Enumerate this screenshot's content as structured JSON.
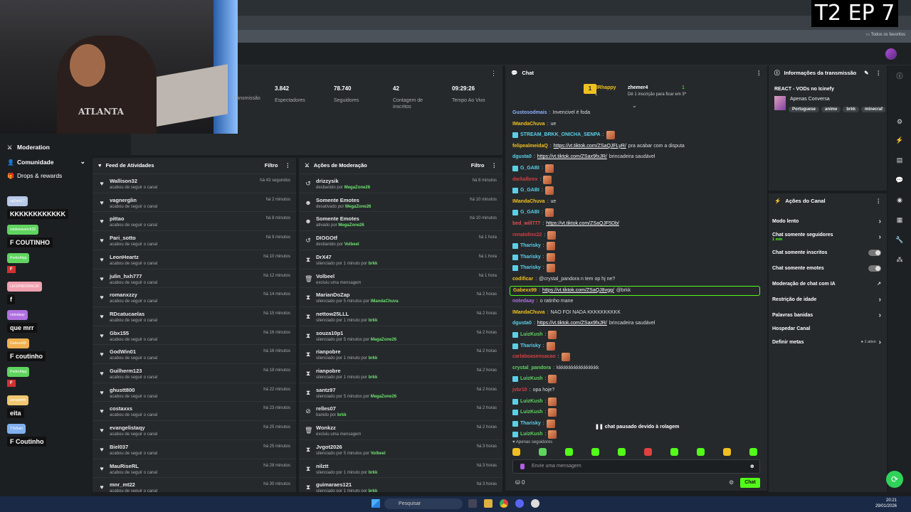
{
  "overlay": {
    "episode": "T2 EP 7",
    "webcam_shirt_text": "ATLANTA"
  },
  "browser": {
    "bookmarks_folder": "Todos os favoritos"
  },
  "sidebar": {
    "items": [
      {
        "label": "Moderation",
        "icon": "sword-icon"
      },
      {
        "label": "Comunidade",
        "icon": "user-icon"
      },
      {
        "label": "Drops & rewards",
        "icon": "gift-icon"
      }
    ]
  },
  "chat_overlay": [
    {
      "user": "og5am17",
      "msg": "KKKKKKKKKKKK",
      "color": "#b8c8e8"
    },
    {
      "user": "voidweaverch32",
      "msg": "F COUTINHO",
      "color": "#5fd45f"
    },
    {
      "user": "PedroAlqq",
      "msg": "F",
      "color": "#5fd45f"
    },
    {
      "user": "LEOZINDGRAL00",
      "msg": "f",
      "color": "#f0a0b0"
    },
    {
      "user": "notedaay",
      "msg": "que mrr",
      "color": "#b070e0"
    },
    {
      "user": "Gabexx99",
      "msg": "F coutinho",
      "color": "#f0b050"
    },
    {
      "user": "PedroAlqq",
      "msg": "F",
      "color": "#5fd45f"
    },
    {
      "user": "zarapafrih",
      "msg": "eita",
      "color": "#f0c870"
    },
    {
      "user": "TTo5am",
      "msg": "F Coutinho",
      "color": "#80b0f0"
    }
  ],
  "stats": [
    {
      "value": "",
      "label": "Transmissão"
    },
    {
      "value": "3.842",
      "label": "Espectadores"
    },
    {
      "value": "78.740",
      "label": "Seguidores"
    },
    {
      "value": "42",
      "label": "Contagem de inscritos"
    },
    {
      "value": "09:29:26",
      "label": "Tempo Ao Vivo"
    }
  ],
  "activity": {
    "title": "Feed de Atividades",
    "filter": "Filtro",
    "rows": [
      {
        "name": "Wallison32",
        "sub": "acabou de seguir o canal",
        "time": "há 43 segundos"
      },
      {
        "name": "vagnerglin",
        "sub": "acabou de seguir o canal",
        "time": "há 2 minutos"
      },
      {
        "name": "pittao",
        "sub": "acabou de seguir o canal",
        "time": "há 8 minutos"
      },
      {
        "name": "Pari_sotto",
        "sub": "acabou de seguir o canal",
        "time": "há 9 minutos"
      },
      {
        "name": "LeonHeartz",
        "sub": "acabou de seguir o canal",
        "time": "há 10 minutos"
      },
      {
        "name": "julin_hxh777",
        "sub": "acabou de seguir o canal",
        "time": "há 12 minutos"
      },
      {
        "name": "romanxzzy",
        "sub": "acabou de seguir o canal",
        "time": "há 14 minutos"
      },
      {
        "name": "RDcatucaelas",
        "sub": "acabou de seguir o canal",
        "time": "há 15 minutos"
      },
      {
        "name": "Gbx155",
        "sub": "acabou de seguir o canal",
        "time": "há 16 minutos"
      },
      {
        "name": "GodWin01",
        "sub": "acabou de seguir o canal",
        "time": "há 16 minutos"
      },
      {
        "name": "Guilherm123",
        "sub": "acabou de seguir o canal",
        "time": "há 18 minutos"
      },
      {
        "name": "ghustt800",
        "sub": "acabou de seguir o canal",
        "time": "há 22 minutos"
      },
      {
        "name": "costaxxs",
        "sub": "acabou de seguir o canal",
        "time": "há 23 minutos"
      },
      {
        "name": "evangelistaqy",
        "sub": "acabou de seguir o canal",
        "time": "há 25 minutos"
      },
      {
        "name": "Biel037",
        "sub": "acabou de seguir o canal",
        "time": "há 25 minutos"
      },
      {
        "name": "MauRiseRL",
        "sub": "acabou de seguir o canal",
        "time": "há 28 minutos"
      },
      {
        "name": "mnr_mt22",
        "sub": "acabou de seguir o canal",
        "time": "há 30 minutos"
      }
    ]
  },
  "moderation": {
    "title": "Ações de Moderação",
    "filter": "Filtro",
    "rows": [
      {
        "name": "drizzysik",
        "sub_pre": "desbanido por",
        "by": "MegaZone26",
        "time": "há 8 minutos",
        "icon": "undo-icon"
      },
      {
        "name": "Somente Emotes",
        "sub_pre": "desativado por",
        "by": "MegaZone26",
        "time": "há 10 minutos",
        "icon": "emote-icon"
      },
      {
        "name": "Somente Emotes",
        "sub_pre": "ativado por",
        "by": "MegaZone26",
        "time": "há 10 minutos",
        "icon": "emote-icon"
      },
      {
        "name": "DIOGOtf",
        "sub_pre": "desbanido por",
        "by": "Volbeel",
        "time": "há 1 hora",
        "icon": "undo-icon"
      },
      {
        "name": "DrX47",
        "sub_pre": "silenciado por 1 minuto por",
        "by": "brkk",
        "time": "há 1 hora",
        "icon": "hourglass-icon"
      },
      {
        "name": "Volbeel",
        "sub_pre": "excluiu uma mensagem",
        "by": "",
        "time": "há 1 hora",
        "icon": "trash-icon"
      },
      {
        "name": "MarianDoZap",
        "sub_pre": "silenciado por 5 minutos por",
        "by": "IMandaChuva",
        "time": "há 2 horas",
        "icon": "hourglass-icon"
      },
      {
        "name": "nettow25LLL",
        "sub_pre": "silenciado por 1 minuto por",
        "by": "brkk",
        "time": "há 2 horas",
        "icon": "hourglass-icon"
      },
      {
        "name": "souza10p1",
        "sub_pre": "silenciado por 5 minutos por",
        "by": "MegaZone26",
        "time": "há 2 horas",
        "icon": "hourglass-icon"
      },
      {
        "name": "rianpobre",
        "sub_pre": "silenciado por 1 minuto por",
        "by": "brkk",
        "time": "há 2 horas",
        "icon": "hourglass-icon"
      },
      {
        "name": "rianpobre",
        "sub_pre": "silenciado por 1 minuto por",
        "by": "brkk",
        "time": "há 2 horas",
        "icon": "hourglass-icon"
      },
      {
        "name": "santz97",
        "sub_pre": "silenciado por 5 minutos por",
        "by": "MegaZone26",
        "time": "há 2 horas",
        "icon": "hourglass-icon"
      },
      {
        "name": "relles07",
        "sub_pre": "banido por",
        "by": "brkk",
        "time": "há 2 horas",
        "icon": "ban-icon"
      },
      {
        "name": "Wonkzz",
        "sub_pre": "excluiu uma mensagem",
        "by": "",
        "time": "há 2 horas",
        "icon": "trash-icon"
      },
      {
        "name": "Jvgot2026",
        "sub_pre": "silenciado por 5 minutos por",
        "by": "Volbeel",
        "time": "há 3 horas",
        "icon": "hourglass-icon"
      },
      {
        "name": "nilztt",
        "sub_pre": "silenciado por 1 minuto por",
        "by": "brkk",
        "time": "há 3 horas",
        "icon": "hourglass-icon"
      },
      {
        "name": "guimaraes121",
        "sub_pre": "silenciado por 1 minuto por",
        "by": "brkk",
        "time": "há 3 horas",
        "icon": "hourglass-icon"
      }
    ]
  },
  "chat": {
    "title": "Chat",
    "leaders": [
      {
        "name": "JRhappy",
        "count": "1"
      },
      {
        "name": "zhemer4",
        "count": "1"
      }
    ],
    "leader_note": "Dê 1 inscrição para ficar em 3º",
    "messages": [
      {
        "user": "Gustosodmais",
        "color": "#8fb0ff",
        "text": "Invencivel é foda",
        "link": "",
        "tail": "",
        "emote": false
      },
      {
        "user": "IMandaChuva",
        "color": "#f0c020",
        "text": "ue",
        "link": "",
        "tail": "",
        "emote": false
      },
      {
        "user": "STREAM_BRKK_ONICHA_SENPA",
        "color": "#5ad0e8",
        "text": "",
        "link": "",
        "tail": "",
        "emote": true
      },
      {
        "user": "felipealmeidaQ",
        "color": "#f0c020",
        "text": "",
        "link": "https://vt.tiktok.com/ZSaQJFLyR/",
        "tail": "pra acabar com a disputa",
        "emote": false
      },
      {
        "user": "dgusta0",
        "color": "#5ad0e8",
        "text": "",
        "link": "https://vt.tiktok.com/ZSax9fxJR/",
        "tail": "brincadeira saudável",
        "emote": false
      },
      {
        "user": "G_GABI",
        "color": "#5ad0e8",
        "text": "",
        "link": "",
        "tail": "",
        "emote": true
      },
      {
        "user": "darkalbrex",
        "color": "#d04040",
        "text": "",
        "link": "",
        "tail": "",
        "emote": true
      },
      {
        "user": "G_GABI",
        "color": "#5ad0e8",
        "text": "",
        "link": "",
        "tail": "",
        "emote": true
      },
      {
        "user": "IMandaChuva",
        "color": "#f0c020",
        "text": "ue",
        "link": "",
        "tail": "",
        "emote": false
      },
      {
        "user": "G_GABI",
        "color": "#5ad0e8",
        "text": "",
        "link": "",
        "tail": "",
        "emote": true
      },
      {
        "user": "bed_will777",
        "color": "#e05050",
        "text": "",
        "link": "https://vt.tiktok.com/ZSaQJF5Db/",
        "tail": "",
        "emote": false
      },
      {
        "user": "renatolinx22",
        "color": "#d04040",
        "text": "",
        "link": "",
        "tail": "",
        "emote": true
      },
      {
        "user": "Tharisky",
        "color": "#5ad0e8",
        "text": "",
        "link": "",
        "tail": "",
        "emote": true
      },
      {
        "user": "Tharisky",
        "color": "#5ad0e8",
        "text": "",
        "link": "",
        "tail": "",
        "emote": true
      },
      {
        "user": "Tharisky",
        "color": "#5ad0e8",
        "text": "",
        "link": "",
        "tail": "",
        "emote": true
      },
      {
        "user": "codificar",
        "color": "#f0c020",
        "text": "@crystal_pandora n tem op hj ne?",
        "link": "",
        "tail": "",
        "emote": false
      },
      {
        "user": "Gabexx99",
        "color": "#f0c020",
        "text": "",
        "link": "https://vt.tiktok.com/ZSaQJ8vgg/",
        "tail": "@brkk",
        "emote": false
      },
      {
        "user": "notedaay",
        "color": "#b070e0",
        "text": "o ratinho mane",
        "link": "",
        "tail": "",
        "emote": false
      },
      {
        "user": "IMandaChuva",
        "color": "#f0c020",
        "text": "NAO FOI NADA KKKKKKKKKK",
        "link": "",
        "tail": "",
        "emote": false
      },
      {
        "user": "dgusta0",
        "color": "#5ad0e8",
        "text": "",
        "link": "https://vt.tiktok.com/ZSax9fxJR/",
        "tail": "brincadeira saudável",
        "emote": false
      },
      {
        "user": "LuizKush",
        "color": "#5fd45f",
        "text": "",
        "link": "",
        "tail": "",
        "emote": true
      },
      {
        "user": "Tharisky",
        "color": "#5ad0e8",
        "text": "",
        "link": "",
        "tail": "",
        "emote": true
      },
      {
        "user": "carlaboasensacao",
        "color": "#d04040",
        "text": "",
        "link": "",
        "tail": "",
        "emote": true
      },
      {
        "user": "crystal_pandora",
        "color": "#5fd45f",
        "text": "kkkkkkkkkkkkkkkkk",
        "link": "",
        "tail": "",
        "emote": false
      },
      {
        "user": "LuizKush",
        "color": "#5fd45f",
        "text": "",
        "link": "",
        "tail": "",
        "emote": true
      },
      {
        "user": "jvbr10",
        "color": "#d04040",
        "text": "opa hoje?",
        "link": "",
        "tail": "",
        "emote": false
      },
      {
        "user": "LuizKush",
        "color": "#5fd45f",
        "text": "",
        "link": "",
        "tail": "",
        "emote": true
      },
      {
        "user": "LuizKush",
        "color": "#5fd45f",
        "text": "",
        "link": "",
        "tail": "",
        "emote": true
      },
      {
        "user": "Tharisky",
        "color": "#5ad0e8",
        "text": "",
        "link": "",
        "tail": "",
        "emote": true
      },
      {
        "user": "LuizKush",
        "color": "#5fd45f",
        "text": "",
        "link": "",
        "tail": "",
        "emote": true
      }
    ],
    "paused": "chat pausado devido à rolagem",
    "followers_only": "Apenas seguidores",
    "input_placeholder": "Envie uma mensagem",
    "points": "0",
    "send": "Chat"
  },
  "info": {
    "title": "Informações da transmissão",
    "stream_title": "REACT - VODs no Icinefy",
    "category": "Apenas Conversa",
    "tags": [
      "Portuguese",
      "anime",
      "brkk",
      "minecraf"
    ]
  },
  "actions": {
    "title": "Ações do Canal",
    "items": [
      {
        "label": "Modo lento",
        "kind": "chevron",
        "sub": "",
        "extra": ""
      },
      {
        "label": "Chat somente seguidores",
        "kind": "chevron",
        "sub": "1 min",
        "extra": ""
      },
      {
        "label": "Chat somente inscritos",
        "kind": "toggle",
        "sub": "",
        "extra": ""
      },
      {
        "label": "Chat somente emotes",
        "kind": "toggle",
        "sub": "",
        "extra": ""
      },
      {
        "label": "Moderação de chat com IA",
        "kind": "external",
        "sub": "",
        "extra": ""
      },
      {
        "label": "Restrição de idade",
        "kind": "chevron",
        "sub": "",
        "extra": ""
      },
      {
        "label": "Palavras banidas",
        "kind": "chevron",
        "sub": "",
        "extra": ""
      },
      {
        "label": "Hospedar Canal",
        "kind": "none",
        "sub": "",
        "extra": ""
      },
      {
        "label": "Definir metas",
        "kind": "chevron",
        "sub": "",
        "extra": "1 ativo"
      }
    ]
  },
  "taskbar": {
    "search": "Pesquisar",
    "time": "20:21",
    "date": "29/01/2026"
  },
  "colors": {
    "accent": "#53fc18",
    "panel": "#25292c",
    "bg": "#1a1d1f"
  }
}
